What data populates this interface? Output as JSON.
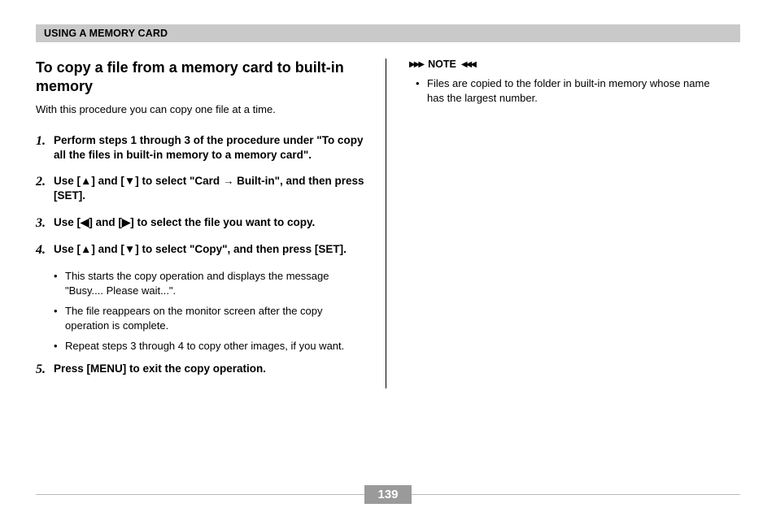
{
  "header": "USING A MEMORY CARD",
  "title": "To copy a file from a memory card to built-in memory",
  "intro": "With this procedure you can copy one file at a time.",
  "steps": [
    {
      "num": "1.",
      "text": "Perform steps 1 through 3 of the procedure under \"To copy all the files in built-in memory to a memory card\"."
    },
    {
      "num": "2.",
      "text": "Use [▲] and [▼] to select \"Card → Built-in\", and then press [SET]."
    },
    {
      "num": "3.",
      "text": "Use [◀] and [▶] to select the file you want to copy."
    },
    {
      "num": "4.",
      "text": "Use [▲] and [▼] to select \"Copy\", and then press [SET].",
      "sub": [
        "This starts the copy operation and displays the message \"Busy.... Please wait...\".",
        "The file reappears on the monitor screen after the copy operation is complete.",
        "Repeat steps 3 through 4 to copy other images, if you want."
      ]
    },
    {
      "num": "5.",
      "text": "Press [MENU] to exit the copy operation."
    }
  ],
  "note": {
    "label": "NOTE",
    "body": "Files are copied to the folder in built-in memory whose name has the largest number."
  },
  "pageNumber": "139"
}
